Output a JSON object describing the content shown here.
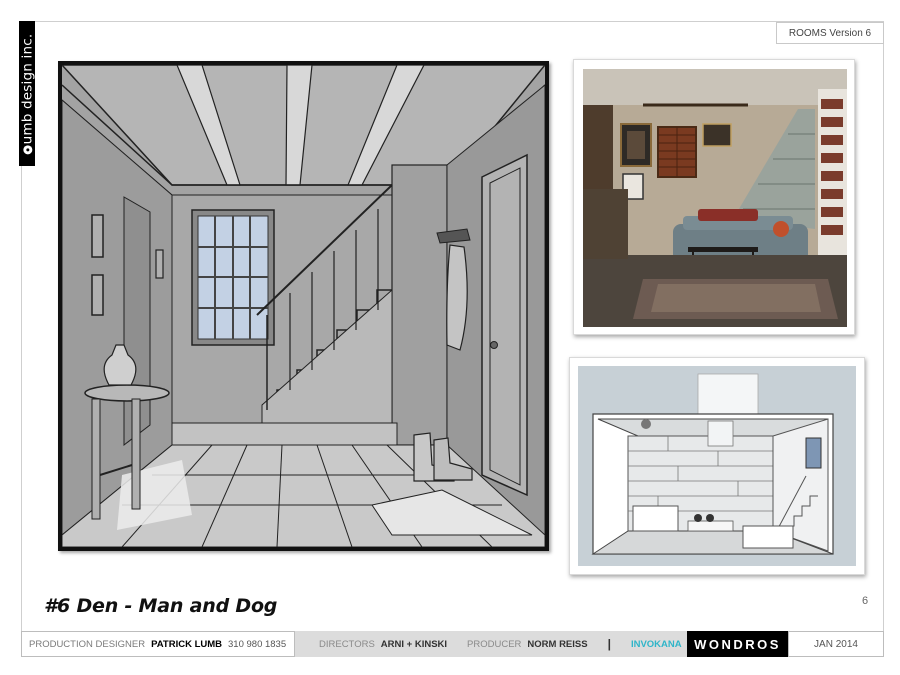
{
  "header": {
    "logo_text": "umb design inc.",
    "version": "ROOMS Version 6"
  },
  "slide": {
    "title": "#6 Den  - Man and Dog",
    "page_number": "6"
  },
  "footer": {
    "production_designer_label": "PRODUCTION DESIGNER",
    "production_designer_name": "PATRICK LUMB",
    "phone": "310 980 1835",
    "directors_label": "DIRECTORS",
    "directors_name": "ARNI + KINSKI",
    "producer_label": "PRODUCER",
    "producer_name": "NORM REISS",
    "separator": "|",
    "client": "INVOKANA",
    "agency": "WONDROS",
    "date": "JAN  2014"
  },
  "colors": {
    "client_accent": "#2fb5c9",
    "sketch_gray": "#9e9e9e",
    "model_background": "#c7d0d6"
  }
}
